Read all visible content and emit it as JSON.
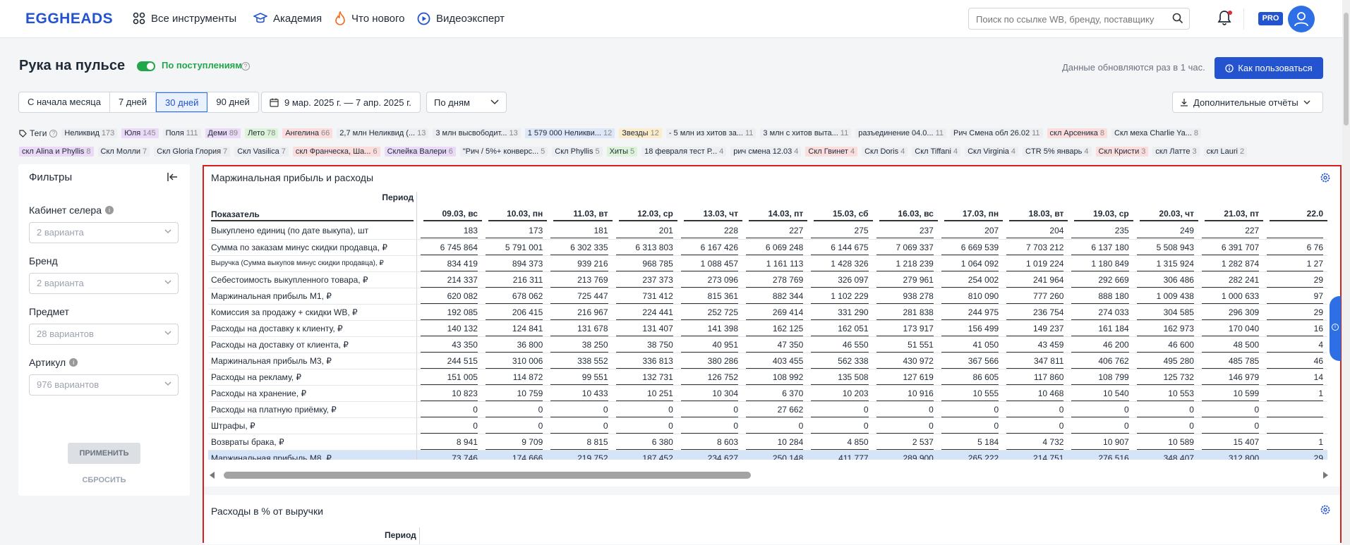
{
  "header": {
    "logo": "EGGHEADS",
    "nav": [
      {
        "label": "Все инструменты",
        "icon": "grid-icon"
      },
      {
        "label": "Академия",
        "icon": "graduation-cap-icon"
      },
      {
        "label": "Что нового",
        "icon": "fire-icon"
      },
      {
        "label": "Видеоэксперт",
        "icon": "play-circle-icon"
      }
    ],
    "search_placeholder": "Поиск по ссылке WB, бренду, поставщику",
    "pro_badge": "PRO"
  },
  "page": {
    "title": "Рука на пульсе",
    "toggle_label": "По поступлениям",
    "update_text": "Данные обновляются раз в 1 час.",
    "how_to_button": "Как пользоваться",
    "ranges": [
      "С начала месяца",
      "7 дней",
      "30 дней",
      "90 дней"
    ],
    "active_range": "30 дней",
    "date_range": "9 мар. 2025 г. — 7 апр. 2025 г.",
    "period_select": "По дням",
    "reports_button": "Дополнительные отчёты"
  },
  "tags": {
    "label": "Теги",
    "row1": [
      {
        "name": "Неликвид",
        "count": "173",
        "color": "#eceef1"
      },
      {
        "name": "Юля",
        "count": "145",
        "color": "#ead9f7"
      },
      {
        "name": "Поля",
        "count": "111",
        "color": "#eceef1"
      },
      {
        "name": "Деми",
        "count": "89",
        "color": "#ead9f7"
      },
      {
        "name": "Лето",
        "count": "78",
        "color": "#dcf3d9"
      },
      {
        "name": "Ангелина",
        "count": "66",
        "color": "#fbdddd"
      },
      {
        "name": "2,7 млн Неликвид (...",
        "count": "13",
        "color": "#eceef1"
      },
      {
        "name": "3 млн высвободит...",
        "count": "13",
        "color": "#eceef1"
      },
      {
        "name": "1 579 000 Неликви...",
        "count": "12",
        "color": "#dde7f8"
      },
      {
        "name": "Звезды",
        "count": "12",
        "color": "#fbeccb"
      },
      {
        "name": "- 5 млн из хитов за...",
        "count": "11",
        "color": "#eceef1"
      },
      {
        "name": "3 млн с хитов выта...",
        "count": "11",
        "color": "#eceef1"
      },
      {
        "name": "разъединение 04.0...",
        "count": "11",
        "color": "#eceef1"
      },
      {
        "name": "Рич Смена обл 26.02",
        "count": "11",
        "color": "#eceef1"
      },
      {
        "name": "скл Арсеника",
        "count": "8",
        "color": "#fbdddd"
      },
      {
        "name": "Скл меха Charlie Ya...",
        "count": "8",
        "color": "#eceef1"
      }
    ],
    "row2": [
      {
        "name": "скл Alina и Phyllis",
        "count": "8",
        "color": "#ead9f7"
      },
      {
        "name": "Скл Молли",
        "count": "7",
        "color": "#eceef1"
      },
      {
        "name": "Скл Gloria Глория",
        "count": "7",
        "color": "#eceef1"
      },
      {
        "name": "Скл Vasilica",
        "count": "7",
        "color": "#eceef1"
      },
      {
        "name": "скл Франческа, Ша...",
        "count": "6",
        "color": "#fbdddd"
      },
      {
        "name": "Склейка Валери",
        "count": "6",
        "color": "#ead9f7"
      },
      {
        "name": "\"Рич / 5%+ конверс...",
        "count": "5",
        "color": "#eceef1"
      },
      {
        "name": "Скл Phyllis",
        "count": "5",
        "color": "#eceef1"
      },
      {
        "name": "Хиты",
        "count": "5",
        "color": "#dcf3d9"
      },
      {
        "name": "18 февраля тест Р...",
        "count": "4",
        "color": "#eceef1"
      },
      {
        "name": "рич смена 12.03",
        "count": "4",
        "color": "#eceef1"
      },
      {
        "name": "Скл Гвинет",
        "count": "4",
        "color": "#fbdddd"
      },
      {
        "name": "Скл Doris",
        "count": "4",
        "color": "#eceef1"
      },
      {
        "name": "Скл Tiffani",
        "count": "4",
        "color": "#eceef1"
      },
      {
        "name": "Скл Virginia",
        "count": "4",
        "color": "#eceef1"
      },
      {
        "name": "CTR 5% январь",
        "count": "4",
        "color": "#eceef1"
      },
      {
        "name": "Скл Кристи",
        "count": "3",
        "color": "#fbdddd"
      },
      {
        "name": "скл Латте",
        "count": "3",
        "color": "#eceef1"
      },
      {
        "name": "скл Lauri",
        "count": "2",
        "color": "#eceef1"
      }
    ]
  },
  "filters": {
    "title": "Фильтры",
    "fields": [
      {
        "label": "Кабинет селера",
        "value": "2 варианта",
        "info": true
      },
      {
        "label": "Бренд",
        "value": "2 варианта",
        "info": false
      },
      {
        "label": "Предмет",
        "value": "28 вариантов",
        "info": false
      },
      {
        "label": "Артикул",
        "value": "976 вариантов",
        "info": true
      }
    ],
    "apply": "ПРИМЕНИТЬ",
    "reset": "СБРОСИТЬ"
  },
  "margin_table": {
    "title": "Маржинальная прибыль и расходы",
    "period_label": "Период",
    "indicator_label": "Показатель",
    "dates": [
      "09.03, вс",
      "10.03, пн",
      "11.03, вт",
      "12.03, ср",
      "13.03, чт",
      "14.03, пт",
      "15.03, сб",
      "16.03, вс",
      "17.03, пн",
      "18.03, вт",
      "19.03, ср",
      "20.03, чт",
      "21.03, пт",
      "22.0"
    ],
    "rows": [
      {
        "label": "Выкуплено единиц (по дате выкупа), шт",
        "values": [
          "183",
          "173",
          "181",
          "201",
          "228",
          "227",
          "275",
          "237",
          "207",
          "204",
          "235",
          "249",
          "227",
          ""
        ]
      },
      {
        "label": "Сумма по заказам минус скидки продавца, ₽",
        "values": [
          "6 745 864",
          "5 791 001",
          "6 302 335",
          "6 313 803",
          "6 167 426",
          "6 069 248",
          "6 144 675",
          "7 069 337",
          "6 669 539",
          "7 703 212",
          "6 137 180",
          "5 508 943",
          "6 391 707",
          "6 76"
        ]
      },
      {
        "label": "Выручка (Сумма выкупов минус скидки продавца), ₽",
        "values": [
          "834 419",
          "894 373",
          "939 216",
          "968 785",
          "1 088 457",
          "1 161 113",
          "1 428 326",
          "1 218 239",
          "1 064 092",
          "1 019 224",
          "1 180 849",
          "1 315 924",
          "1 282 874",
          "1 27"
        ],
        "small": true
      },
      {
        "label": "Себестоимость выкупленного товара, ₽",
        "values": [
          "214 337",
          "216 311",
          "213 769",
          "237 373",
          "273 096",
          "278 769",
          "326 097",
          "279 961",
          "254 002",
          "241 964",
          "292 669",
          "306 486",
          "282 241",
          "29"
        ]
      },
      {
        "label": "Маржинальная прибыль М1, ₽",
        "values": [
          "620 082",
          "678 062",
          "725 447",
          "731 412",
          "815 361",
          "882 344",
          "1 102 229",
          "938 278",
          "810 090",
          "777 260",
          "888 180",
          "1 009 438",
          "1 000 633",
          "97"
        ]
      },
      {
        "label": "Комиссия за продажу + скидки WB, ₽",
        "values": [
          "192 085",
          "206 415",
          "216 967",
          "224 441",
          "252 725",
          "269 414",
          "331 290",
          "281 838",
          "244 975",
          "236 754",
          "274 033",
          "304 585",
          "296 309",
          "29"
        ]
      },
      {
        "label": "Расходы на доставку к клиенту, ₽",
        "values": [
          "140 132",
          "124 841",
          "131 678",
          "131 407",
          "141 398",
          "162 125",
          "162 051",
          "173 917",
          "156 499",
          "149 237",
          "161 184",
          "162 973",
          "170 040",
          "16"
        ]
      },
      {
        "label": "Расходы на доставку от клиента, ₽",
        "values": [
          "43 350",
          "36 800",
          "38 250",
          "38 750",
          "40 951",
          "47 350",
          "46 550",
          "51 551",
          "41 050",
          "43 459",
          "46 200",
          "46 600",
          "48 500",
          "4"
        ]
      },
      {
        "label": "Маржинальная прибыль М3, ₽",
        "values": [
          "244 515",
          "310 006",
          "338 552",
          "336 813",
          "380 286",
          "403 455",
          "562 338",
          "430 972",
          "367 566",
          "347 811",
          "406 762",
          "495 280",
          "485 785",
          "46"
        ]
      },
      {
        "label": "Расходы на рекламу, ₽",
        "values": [
          "151 005",
          "114 872",
          "99 551",
          "132 731",
          "126 752",
          "108 992",
          "135 508",
          "127 619",
          "86 605",
          "117 860",
          "108 799",
          "125 732",
          "146 979",
          "14"
        ]
      },
      {
        "label": "Расходы на хранение, ₽",
        "values": [
          "10 823",
          "10 759",
          "10 433",
          "10 251",
          "10 304",
          "6 370",
          "10 203",
          "10 916",
          "10 555",
          "10 468",
          "10 540",
          "10 553",
          "10 599",
          "1"
        ]
      },
      {
        "label": "Расходы на платную приёмку, ₽",
        "values": [
          "0",
          "0",
          "0",
          "0",
          "0",
          "27 662",
          "0",
          "0",
          "0",
          "0",
          "0",
          "0",
          "0",
          ""
        ]
      },
      {
        "label": "Штрафы, ₽",
        "values": [
          "0",
          "0",
          "0",
          "0",
          "0",
          "0",
          "0",
          "0",
          "0",
          "0",
          "0",
          "0",
          "0",
          ""
        ]
      },
      {
        "label": "Возвраты брака, ₽",
        "values": [
          "8 941",
          "9 709",
          "8 815",
          "6 380",
          "8 603",
          "10 284",
          "4 850",
          "2 537",
          "5 184",
          "4 732",
          "10 907",
          "10 589",
          "15 407",
          "1"
        ]
      },
      {
        "label": "Маржинальная прибыль М8, ₽",
        "values": [
          "73 746",
          "174 666",
          "219 752",
          "187 452",
          "234 627",
          "250 148",
          "411 777",
          "289 900",
          "265 222",
          "214 751",
          "276 516",
          "348 407",
          "312 800",
          "29"
        ],
        "highlight": true
      }
    ]
  },
  "percent_table": {
    "title": "Расходы в % от выручки",
    "period_label": "Период"
  }
}
